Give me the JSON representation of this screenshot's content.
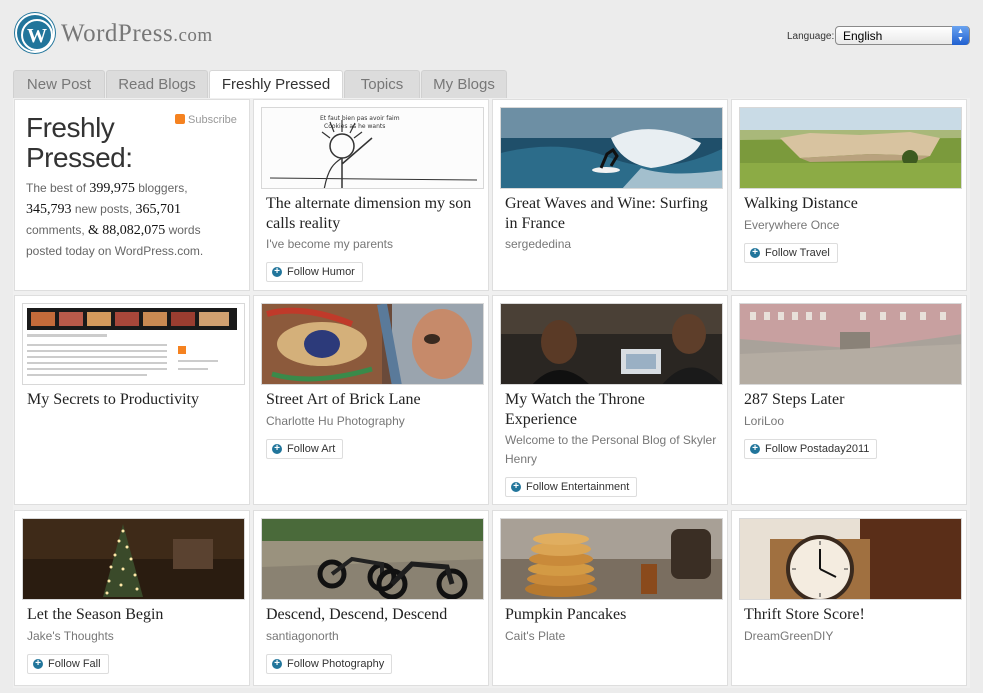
{
  "header": {
    "brand_big": "WordPress",
    "brand_suffix": ".com",
    "language_label": "Language:",
    "language_value": "English"
  },
  "tabs": [
    "New Post",
    "Read Blogs",
    "Freshly Pressed",
    "Topics",
    "My Blogs"
  ],
  "intro": {
    "title_line1": "Freshly",
    "title_line2": "Pressed:",
    "subscribe": "Subscribe",
    "t1": "The best of ",
    "bloggers": "399,975",
    "t2": " bloggers,",
    "posts": "345,793",
    "t3": " new posts, ",
    "comments": "365,701",
    "t4": "comments, ",
    "amp": "&",
    "words": "88,082,075",
    "t5": " words",
    "t6": "posted today on WordPress.com."
  },
  "cards": [
    {
      "title": "The alternate dimension my son calls reality",
      "author": "I've become my parents",
      "follow": "Follow Humor"
    },
    {
      "title": "Great Waves and Wine: Surfing in France",
      "author": "sergededina",
      "follow": ""
    },
    {
      "title": "Walking Distance",
      "author": "Everywhere Once",
      "follow": "Follow Travel"
    },
    {
      "title": "My Secrets to Productivity",
      "author": "",
      "follow": ""
    },
    {
      "title": "Street Art of Brick Lane",
      "author": "Charlotte Hu Photography",
      "follow": "Follow Art"
    },
    {
      "title": "My Watch the Throne Experience",
      "author": "Welcome to the Personal Blog of Skyler Henry",
      "follow": "Follow Entertainment"
    },
    {
      "title": "287 Steps Later",
      "author": "LoriLoo",
      "follow": "Follow Postaday2011"
    },
    {
      "title": "Let the Season Begin",
      "author": "Jake's Thoughts",
      "follow": "Follow Fall"
    },
    {
      "title": "Descend, Descend, Descend",
      "author": "santiagonorth",
      "follow": "Follow Photography"
    },
    {
      "title": "Pumpkin Pancakes",
      "author": "Cait's Plate",
      "follow": ""
    },
    {
      "title": "Thrift Store Score!",
      "author": "DreamGreenDIY",
      "follow": ""
    }
  ],
  "colors": {
    "brand_blue": "#21759b",
    "rss_orange": "#f58220"
  }
}
